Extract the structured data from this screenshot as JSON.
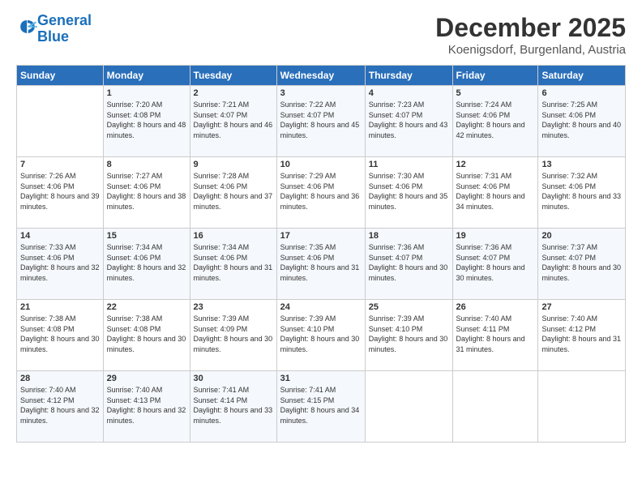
{
  "header": {
    "logo_line1": "General",
    "logo_line2": "Blue",
    "title": "December 2025",
    "location": "Koenigsdorf, Burgenland, Austria"
  },
  "weekdays": [
    "Sunday",
    "Monday",
    "Tuesday",
    "Wednesday",
    "Thursday",
    "Friday",
    "Saturday"
  ],
  "weeks": [
    [
      {
        "day": "",
        "sunrise": "",
        "sunset": "",
        "daylight": ""
      },
      {
        "day": "1",
        "sunrise": "Sunrise: 7:20 AM",
        "sunset": "Sunset: 4:08 PM",
        "daylight": "Daylight: 8 hours and 48 minutes."
      },
      {
        "day": "2",
        "sunrise": "Sunrise: 7:21 AM",
        "sunset": "Sunset: 4:07 PM",
        "daylight": "Daylight: 8 hours and 46 minutes."
      },
      {
        "day": "3",
        "sunrise": "Sunrise: 7:22 AM",
        "sunset": "Sunset: 4:07 PM",
        "daylight": "Daylight: 8 hours and 45 minutes."
      },
      {
        "day": "4",
        "sunrise": "Sunrise: 7:23 AM",
        "sunset": "Sunset: 4:07 PM",
        "daylight": "Daylight: 8 hours and 43 minutes."
      },
      {
        "day": "5",
        "sunrise": "Sunrise: 7:24 AM",
        "sunset": "Sunset: 4:06 PM",
        "daylight": "Daylight: 8 hours and 42 minutes."
      },
      {
        "day": "6",
        "sunrise": "Sunrise: 7:25 AM",
        "sunset": "Sunset: 4:06 PM",
        "daylight": "Daylight: 8 hours and 40 minutes."
      }
    ],
    [
      {
        "day": "7",
        "sunrise": "Sunrise: 7:26 AM",
        "sunset": "Sunset: 4:06 PM",
        "daylight": "Daylight: 8 hours and 39 minutes."
      },
      {
        "day": "8",
        "sunrise": "Sunrise: 7:27 AM",
        "sunset": "Sunset: 4:06 PM",
        "daylight": "Daylight: 8 hours and 38 minutes."
      },
      {
        "day": "9",
        "sunrise": "Sunrise: 7:28 AM",
        "sunset": "Sunset: 4:06 PM",
        "daylight": "Daylight: 8 hours and 37 minutes."
      },
      {
        "day": "10",
        "sunrise": "Sunrise: 7:29 AM",
        "sunset": "Sunset: 4:06 PM",
        "daylight": "Daylight: 8 hours and 36 minutes."
      },
      {
        "day": "11",
        "sunrise": "Sunrise: 7:30 AM",
        "sunset": "Sunset: 4:06 PM",
        "daylight": "Daylight: 8 hours and 35 minutes."
      },
      {
        "day": "12",
        "sunrise": "Sunrise: 7:31 AM",
        "sunset": "Sunset: 4:06 PM",
        "daylight": "Daylight: 8 hours and 34 minutes."
      },
      {
        "day": "13",
        "sunrise": "Sunrise: 7:32 AM",
        "sunset": "Sunset: 4:06 PM",
        "daylight": "Daylight: 8 hours and 33 minutes."
      }
    ],
    [
      {
        "day": "14",
        "sunrise": "Sunrise: 7:33 AM",
        "sunset": "Sunset: 4:06 PM",
        "daylight": "Daylight: 8 hours and 32 minutes."
      },
      {
        "day": "15",
        "sunrise": "Sunrise: 7:34 AM",
        "sunset": "Sunset: 4:06 PM",
        "daylight": "Daylight: 8 hours and 32 minutes."
      },
      {
        "day": "16",
        "sunrise": "Sunrise: 7:34 AM",
        "sunset": "Sunset: 4:06 PM",
        "daylight": "Daylight: 8 hours and 31 minutes."
      },
      {
        "day": "17",
        "sunrise": "Sunrise: 7:35 AM",
        "sunset": "Sunset: 4:06 PM",
        "daylight": "Daylight: 8 hours and 31 minutes."
      },
      {
        "day": "18",
        "sunrise": "Sunrise: 7:36 AM",
        "sunset": "Sunset: 4:07 PM",
        "daylight": "Daylight: 8 hours and 30 minutes."
      },
      {
        "day": "19",
        "sunrise": "Sunrise: 7:36 AM",
        "sunset": "Sunset: 4:07 PM",
        "daylight": "Daylight: 8 hours and 30 minutes."
      },
      {
        "day": "20",
        "sunrise": "Sunrise: 7:37 AM",
        "sunset": "Sunset: 4:07 PM",
        "daylight": "Daylight: 8 hours and 30 minutes."
      }
    ],
    [
      {
        "day": "21",
        "sunrise": "Sunrise: 7:38 AM",
        "sunset": "Sunset: 4:08 PM",
        "daylight": "Daylight: 8 hours and 30 minutes."
      },
      {
        "day": "22",
        "sunrise": "Sunrise: 7:38 AM",
        "sunset": "Sunset: 4:08 PM",
        "daylight": "Daylight: 8 hours and 30 minutes."
      },
      {
        "day": "23",
        "sunrise": "Sunrise: 7:39 AM",
        "sunset": "Sunset: 4:09 PM",
        "daylight": "Daylight: 8 hours and 30 minutes."
      },
      {
        "day": "24",
        "sunrise": "Sunrise: 7:39 AM",
        "sunset": "Sunset: 4:10 PM",
        "daylight": "Daylight: 8 hours and 30 minutes."
      },
      {
        "day": "25",
        "sunrise": "Sunrise: 7:39 AM",
        "sunset": "Sunset: 4:10 PM",
        "daylight": "Daylight: 8 hours and 30 minutes."
      },
      {
        "day": "26",
        "sunrise": "Sunrise: 7:40 AM",
        "sunset": "Sunset: 4:11 PM",
        "daylight": "Daylight: 8 hours and 31 minutes."
      },
      {
        "day": "27",
        "sunrise": "Sunrise: 7:40 AM",
        "sunset": "Sunset: 4:12 PM",
        "daylight": "Daylight: 8 hours and 31 minutes."
      }
    ],
    [
      {
        "day": "28",
        "sunrise": "Sunrise: 7:40 AM",
        "sunset": "Sunset: 4:12 PM",
        "daylight": "Daylight: 8 hours and 32 minutes."
      },
      {
        "day": "29",
        "sunrise": "Sunrise: 7:40 AM",
        "sunset": "Sunset: 4:13 PM",
        "daylight": "Daylight: 8 hours and 32 minutes."
      },
      {
        "day": "30",
        "sunrise": "Sunrise: 7:41 AM",
        "sunset": "Sunset: 4:14 PM",
        "daylight": "Daylight: 8 hours and 33 minutes."
      },
      {
        "day": "31",
        "sunrise": "Sunrise: 7:41 AM",
        "sunset": "Sunset: 4:15 PM",
        "daylight": "Daylight: 8 hours and 34 minutes."
      },
      {
        "day": "",
        "sunrise": "",
        "sunset": "",
        "daylight": ""
      },
      {
        "day": "",
        "sunrise": "",
        "sunset": "",
        "daylight": ""
      },
      {
        "day": "",
        "sunrise": "",
        "sunset": "",
        "daylight": ""
      }
    ]
  ]
}
